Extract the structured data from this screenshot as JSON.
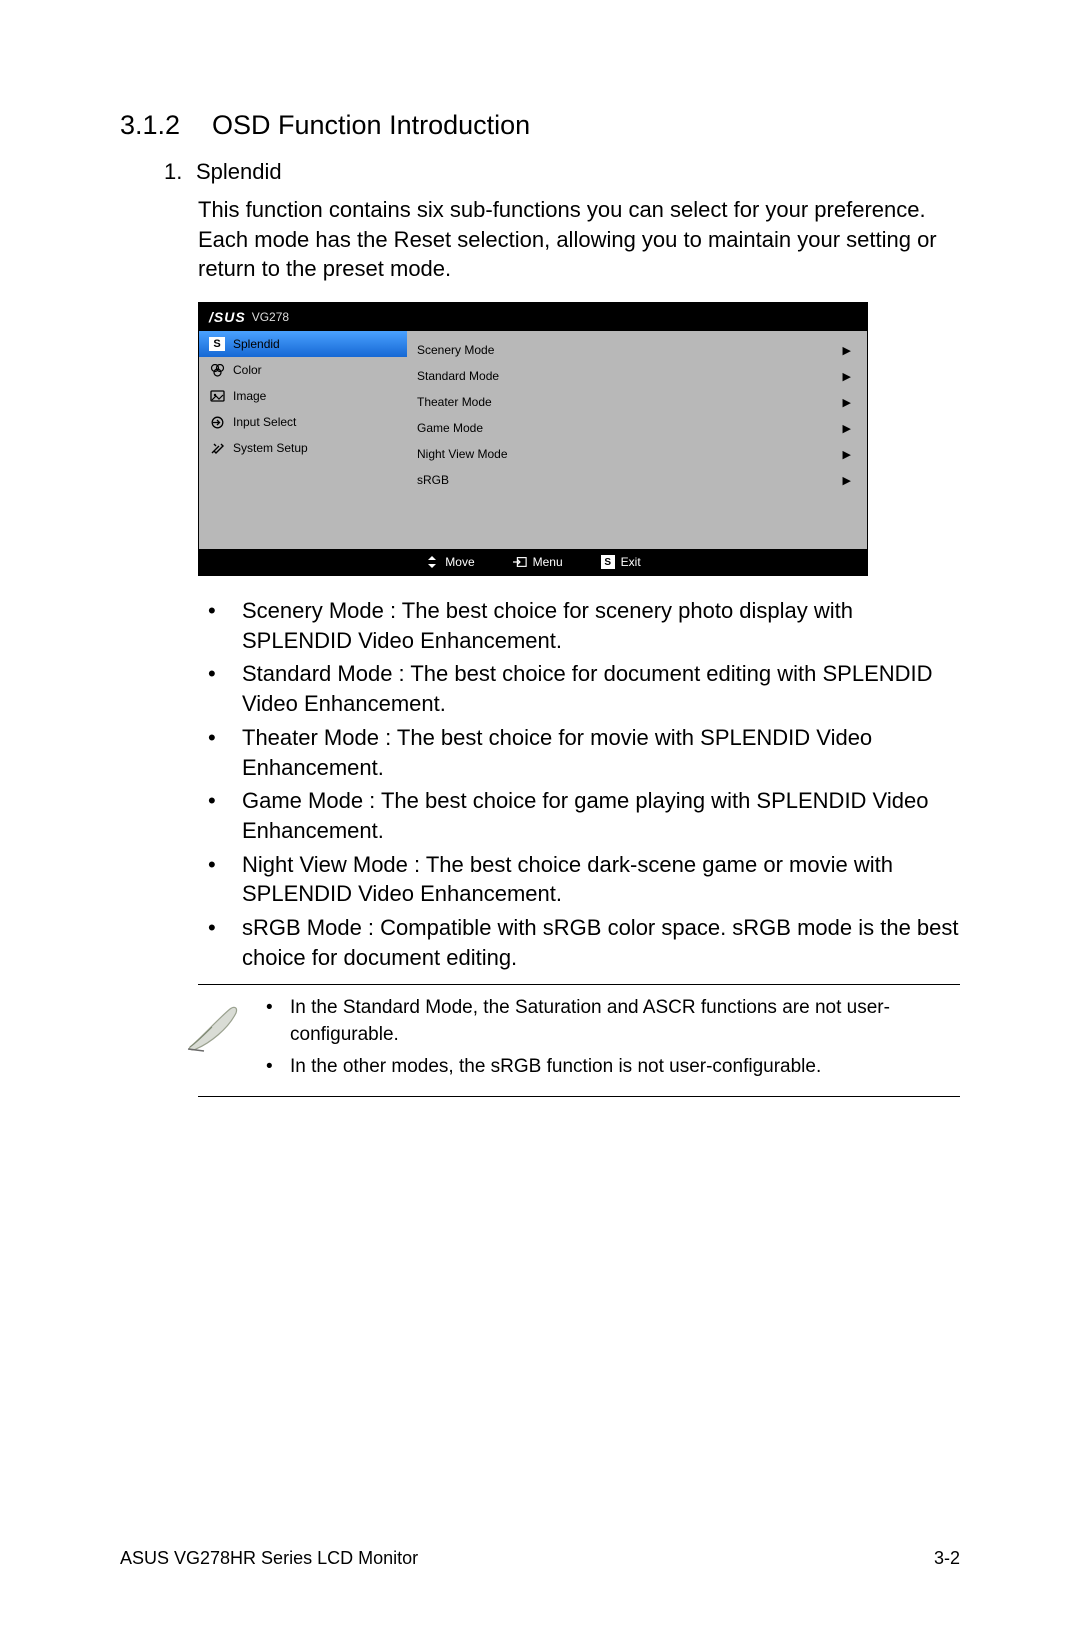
{
  "heading": {
    "number": "3.1.2",
    "title": "OSD Function Introduction"
  },
  "item": {
    "number": "1.",
    "title": "Splendid",
    "description": "This function contains six sub-functions you can select for your preference. Each mode has the Reset selection, allowing you to maintain your setting or return to the preset mode."
  },
  "osd": {
    "logo": "/SUS",
    "model": "VG278",
    "left": [
      {
        "icon": "s",
        "label": "Splendid",
        "selected": true
      },
      {
        "icon": "rgb",
        "label": "Color"
      },
      {
        "icon": "img",
        "label": "Image"
      },
      {
        "icon": "input",
        "label": "Input Select"
      },
      {
        "icon": "tools",
        "label": "System Setup"
      }
    ],
    "right": [
      {
        "label": "Scenery Mode"
      },
      {
        "label": "Standard Mode"
      },
      {
        "label": "Theater Mode"
      },
      {
        "label": "Game Mode"
      },
      {
        "label": "Night View Mode"
      },
      {
        "label": "sRGB"
      }
    ],
    "footer": {
      "move": "Move",
      "menu": "Menu",
      "exit": "Exit"
    }
  },
  "bullets": [
    "Scenery Mode : The best choice for scenery photo display with SPLENDID  Video Enhancement.",
    "Standard Mode : The best choice for document editing with SPLENDID  Video Enhancement.",
    "Theater Mode : The best choice for movie with SPLENDID  Video Enhancement.",
    "Game Mode : The best choice for game playing with SPLENDID  Video Enhancement.",
    "Night View Mode : The best choice dark-scene game or movie with SPLENDID  Video Enhancement.",
    "sRGB Mode : Compatible with sRGB color space. sRGB mode is the best choice for document editing."
  ],
  "notes": [
    "In the Standard Mode, the Saturation and ASCR functions are not user-configurable.",
    "In the other modes, the sRGB function is not user-configurable."
  ],
  "footer": {
    "left": "ASUS VG278HR Series LCD Monitor",
    "right": "3-2"
  }
}
